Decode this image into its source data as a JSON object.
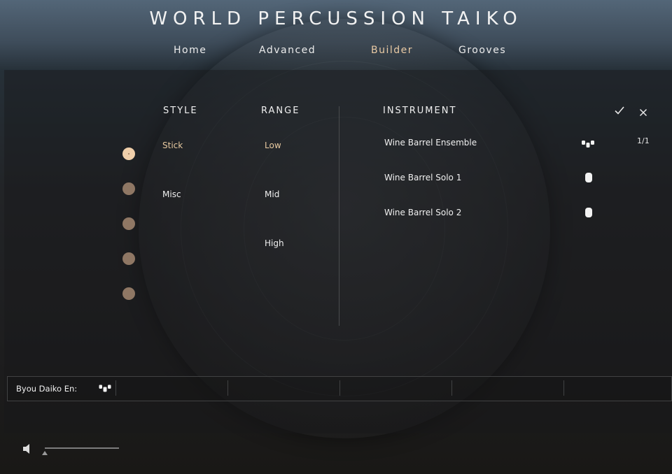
{
  "app": {
    "title": "WORLD PERCUSSION TAIKO"
  },
  "nav": {
    "items": [
      "Home",
      "Advanced",
      "Builder",
      "Grooves"
    ],
    "active": "Builder"
  },
  "style_column": {
    "header": "STYLE",
    "items": [
      "Stick",
      "Misc"
    ],
    "selected": "Stick"
  },
  "range_column": {
    "header": "RANGE",
    "items": [
      "Low",
      "Mid",
      "High"
    ],
    "selected": "Low"
  },
  "instrument_column": {
    "header": "INSTRUMENT",
    "items": [
      {
        "label": "Wine Barrel Ensemble",
        "icon": "ensemble-drums-icon"
      },
      {
        "label": "Wine Barrel Solo 1",
        "icon": "single-drum-icon"
      },
      {
        "label": "Wine Barrel Solo 2",
        "icon": "single-drum-icon"
      }
    ],
    "page_indicator": "1/1",
    "confirm_icon": "checkmark-icon",
    "cancel_icon": "close-icon"
  },
  "selectors": {
    "count": 5,
    "selected_index": 0
  },
  "slot_strip": {
    "slot1_label": "Byou Daiko En:",
    "slot1_icon": "ensemble-drums-icon"
  },
  "volume": {
    "icon": "speaker-icon",
    "level": 0.0
  },
  "colors": {
    "accent": "#e9caa4",
    "selector_dot": "#8f7764",
    "selector_dot_selected": "#f0cfaa"
  }
}
